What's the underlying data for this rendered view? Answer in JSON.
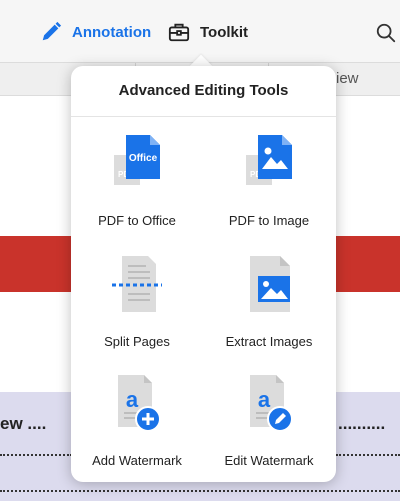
{
  "toolbar": {
    "annotation_label": "Annotation",
    "toolkit_label": "Toolkit",
    "accent_color": "#1a73e8"
  },
  "document": {
    "tab_stub_text": "iew",
    "row_text": "ew ....",
    "row_text_right": "..........",
    "red_band_color": "#c9332b",
    "lavender_color": "#dcdbee"
  },
  "popover": {
    "title": "Advanced Editing Tools",
    "tools": [
      {
        "label": "PDF to Office",
        "icon": "pdf-to-office-icon",
        "badge": "Office",
        "ghost": "PDF"
      },
      {
        "label": "PDF to Image",
        "icon": "pdf-to-image-icon",
        "ghost": "PDF"
      },
      {
        "label": "Split Pages",
        "icon": "split-pages-icon"
      },
      {
        "label": "Extract Images",
        "icon": "extract-images-icon"
      },
      {
        "label": "Add Watermark",
        "icon": "add-watermark-icon",
        "glyph": "a"
      },
      {
        "label": "Edit Watermark",
        "icon": "edit-watermark-icon",
        "glyph": "a"
      }
    ]
  }
}
